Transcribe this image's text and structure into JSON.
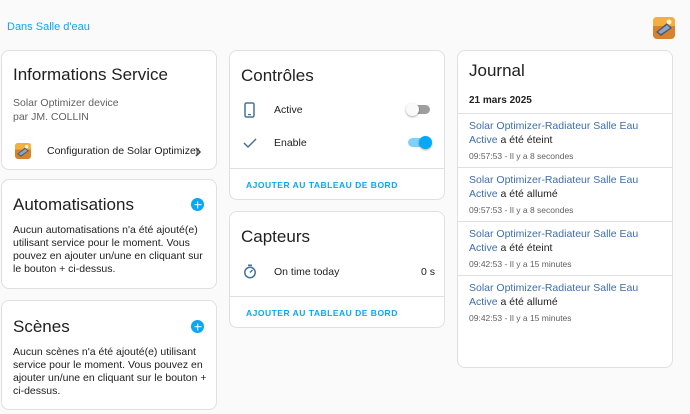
{
  "breadcrumb": "Dans Salle d'eau",
  "info": {
    "title": "Informations Service",
    "device": "Solar Optimizer device",
    "by": "par JM. COLLIN",
    "config_link": "Configuration de Solar Optimizer"
  },
  "automations": {
    "title": "Automatisations",
    "text": "Aucun automatisations n'a été ajouté(e) utilisant service pour le moment. Vous pouvez en ajouter un/une en cliquant sur le bouton + ci-dessus."
  },
  "scenes": {
    "title": "Scènes",
    "text": "Aucun scènes n'a été ajouté(e) utilisant service pour le moment. Vous pouvez en ajouter un/une en cliquant sur le bouton + ci-dessus."
  },
  "controls": {
    "title": "Contrôles",
    "items": [
      {
        "label": "Active",
        "icon": "phone-icon",
        "state": "off"
      },
      {
        "label": "Enable",
        "icon": "check-icon",
        "state": "on"
      }
    ],
    "add_label": "AJOUTER AU TABLEAU DE BORD"
  },
  "sensors": {
    "title": "Capteurs",
    "items": [
      {
        "label": "On time today",
        "value": "0 s",
        "icon": "timer-icon"
      }
    ],
    "add_label": "AJOUTER AU TABLEAU DE BORD"
  },
  "journal": {
    "title": "Journal",
    "date": "21 mars 2025",
    "entries": [
      {
        "name": "Solar Optimizer-Radiateur Salle Eau Active",
        "action": " a été éteint",
        "time": "09:57:53 - Il y a 8 secondes"
      },
      {
        "name": "Solar Optimizer-Radiateur Salle Eau Active",
        "action": " a été allumé",
        "time": "09:57:53 - Il y a 8 secondes"
      },
      {
        "name": "Solar Optimizer-Radiateur Salle Eau Active",
        "action": " a été éteint",
        "time": "09:42:53 - Il y a 15 minutes"
      },
      {
        "name": "Solar Optimizer-Radiateur Salle Eau Active",
        "action": " a été allumé",
        "time": "09:42:53 - Il y a 15 minutes"
      }
    ]
  },
  "colors": {
    "accent": "#03a9f4",
    "link": "#3f6ea8"
  }
}
